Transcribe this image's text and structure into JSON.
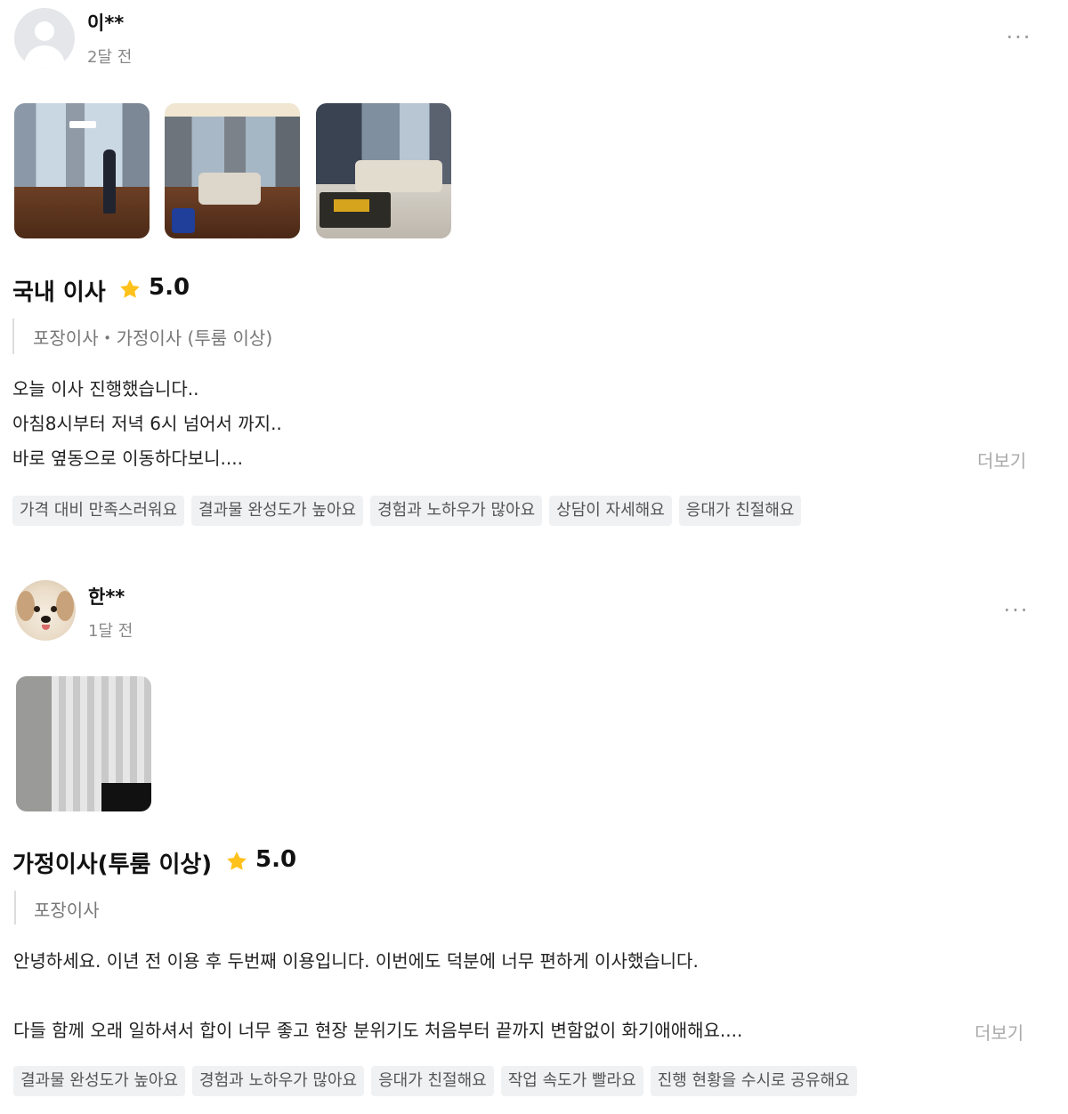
{
  "reviews": [
    {
      "author": "이**",
      "date": "2달 전",
      "avatar": "default-profile-icon",
      "more_icon": "···",
      "photos": [
        "living-room-photo",
        "bedroom-photo",
        "sofa-room-photo"
      ],
      "service_title": "국내 이사",
      "rating": "5.0",
      "subcategories": "포장이사・가정이사 (투룸 이상)",
      "text": "오늘 이사 진행했습니다..\n아침8시부터 저녁 6시 넘어서 까지..\n바로 옆동으로 이동하다보니....",
      "read_more": "더보기",
      "tags": [
        "가격 대비 만족스러워요",
        "결과물 완성도가 높아요",
        "경험과 노하우가 많아요",
        "상담이 자세해요",
        "응대가 친절해요"
      ]
    },
    {
      "author": "한**",
      "date": "1달 전",
      "avatar": "dog-profile-photo",
      "more_icon": "···",
      "photos": [
        "curtain-room-photo"
      ],
      "service_title": "가정이사(투룸 이상)",
      "rating": "5.0",
      "subcategories": "포장이사",
      "text": "안녕하세요. 이년 전 이용 후 두번째 이용입니다. 이번에도 덕분에 너무 편하게 이사했습니다.\n\n다들 함께 오래 일하셔서 합이 너무 좋고 현장 분위기도 처음부터 끝까지 변함없이 화기애애해요....",
      "read_more": "더보기",
      "tags": [
        "결과물 완성도가 높아요",
        "경험과 노하우가 많아요",
        "응대가 친절해요",
        "작업 속도가 빨라요",
        "진행 현황을 수시로 공유해요"
      ]
    }
  ],
  "colors": {
    "star": "#ffc21c",
    "tag_bg": "#f0f1f3",
    "muted_text": "#888888"
  }
}
